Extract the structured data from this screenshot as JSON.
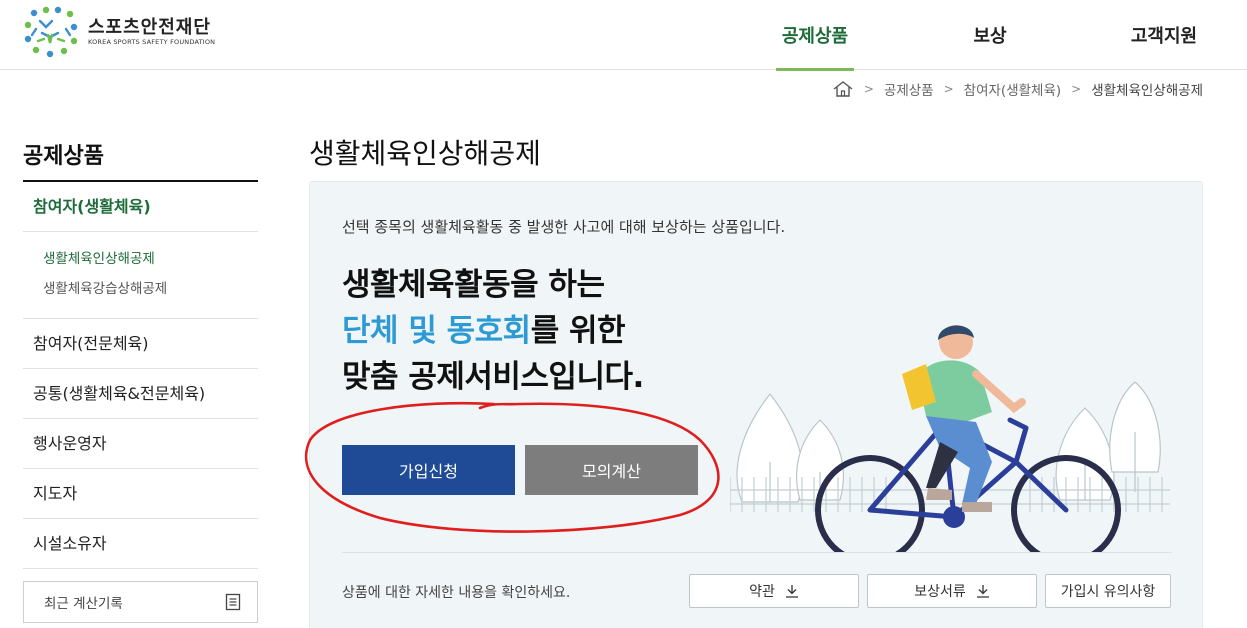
{
  "header": {
    "logo_name": "스포츠안전재단",
    "logo_sub": "KOREA SPORTS SAFETY FOUNDATION",
    "nav": [
      {
        "label": "공제상품",
        "active": true
      },
      {
        "label": "보상",
        "active": false
      },
      {
        "label": "고객지원",
        "active": false
      }
    ]
  },
  "breadcrumb": {
    "items": [
      "공제상품",
      "참여자(생활체육)",
      "생활체육인상해공제"
    ]
  },
  "sidebar": {
    "title": "공제상품",
    "items": [
      {
        "label": "참여자(생활체육)",
        "active": true
      },
      {
        "label": "참여자(전문체육)",
        "active": false
      },
      {
        "label": "공통(생활체육&전문체육)",
        "active": false
      },
      {
        "label": "행사운영자",
        "active": false
      },
      {
        "label": "지도자",
        "active": false
      },
      {
        "label": "시설소유자",
        "active": false
      }
    ],
    "sub_items": [
      {
        "label": "생활체육인상해공제",
        "active": true
      },
      {
        "label": "생활체육강습상해공제",
        "active": false
      }
    ],
    "recent_label": "최근 계산기록"
  },
  "main": {
    "page_title": "생활체육인상해공제",
    "description": "선택 종목의 생활체육활동 중 발생한 사고에 대해 보상하는 상품입니다.",
    "headline_line1": "생활체육활동을 하는",
    "headline_accent": "단체 및 동호회",
    "headline_line2_rest": "를 위한",
    "headline_line3": "맞춤 공제서비스입니다.",
    "join_button": "가입신청",
    "calc_button": "모의계산",
    "more_text": "상품에 대한 자세한 내용을 확인하세요.",
    "doc_buttons": [
      "약관",
      "보상서류",
      "가입시 유의사항"
    ]
  },
  "colors": {
    "brand_green": "#1d6b39",
    "nav_underline": "#7bb95a",
    "accent_blue": "#2e9ad3",
    "join_button": "#1e4a96",
    "calc_button": "#7d7d7d",
    "panel_bg": "#f0f6f8",
    "annotation_red": "#e01e1e"
  }
}
